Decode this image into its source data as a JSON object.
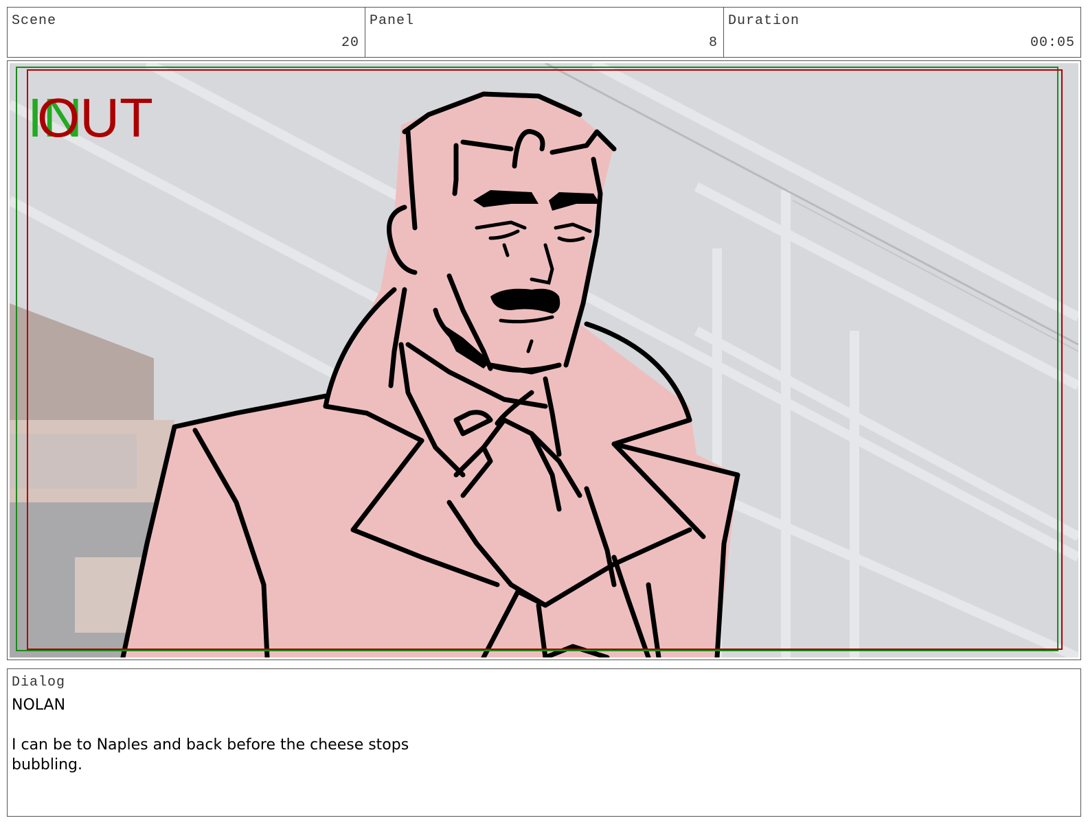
{
  "header": {
    "scene": {
      "label": "Scene",
      "value": "20"
    },
    "panel": {
      "label": "Panel",
      "value": "8"
    },
    "duration": {
      "label": "Duration",
      "value": "00:05"
    }
  },
  "frame": {
    "in_marker": "IN",
    "out_marker": "OUT",
    "in_color": "#22aa22",
    "out_color": "#aa0000"
  },
  "dialog": {
    "label": "Dialog",
    "text": "NOLAN\n\nI can be to Naples and back before the cheese stops\nbubbling."
  }
}
